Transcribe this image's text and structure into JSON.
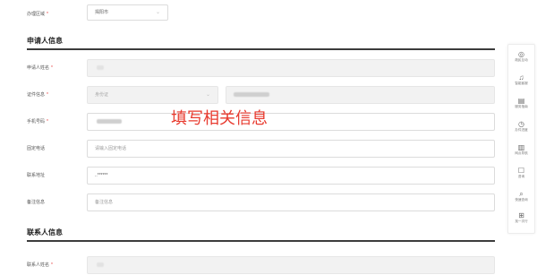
{
  "top_field": {
    "label": "办理区域",
    "value": "揭阳市"
  },
  "applicant": {
    "title": "申请人信息",
    "name_label": "申请人姓名",
    "id_label": "证件信息",
    "id_type": "身份证",
    "phone_label": "手机号码",
    "landline_label": "固定电话",
    "landline_placeholder": "请输入固定电话",
    "address_label": "联系地址",
    "address_value": "..******",
    "remark_label": "备注信息",
    "remark_placeholder": "备注信息"
  },
  "contact": {
    "title": "联系人信息",
    "name_label": "联系人姓名"
  },
  "required_mark": "*",
  "annotation": "填写相关信息",
  "annotation_color": "#e83a2e",
  "sidebar": {
    "items": [
      {
        "icon": "chat-icon",
        "glyph": "◎",
        "label": "政民互动"
      },
      {
        "icon": "headset-icon",
        "glyph": "♫",
        "label": "智能客服"
      },
      {
        "icon": "guide-icon",
        "glyph": "▤",
        "label": "服务指南"
      },
      {
        "icon": "clock-icon",
        "glyph": "◷",
        "label": "办件进度"
      },
      {
        "icon": "office-icon",
        "glyph": "▥",
        "label": "网点导航"
      },
      {
        "icon": "feedback-icon",
        "glyph": "☐",
        "label": "咨询"
      },
      {
        "icon": "search-icon",
        "glyph": "⌕",
        "label": "快速查询"
      },
      {
        "icon": "one-stop-icon",
        "glyph": "⊞",
        "label": "找一次行"
      }
    ]
  }
}
